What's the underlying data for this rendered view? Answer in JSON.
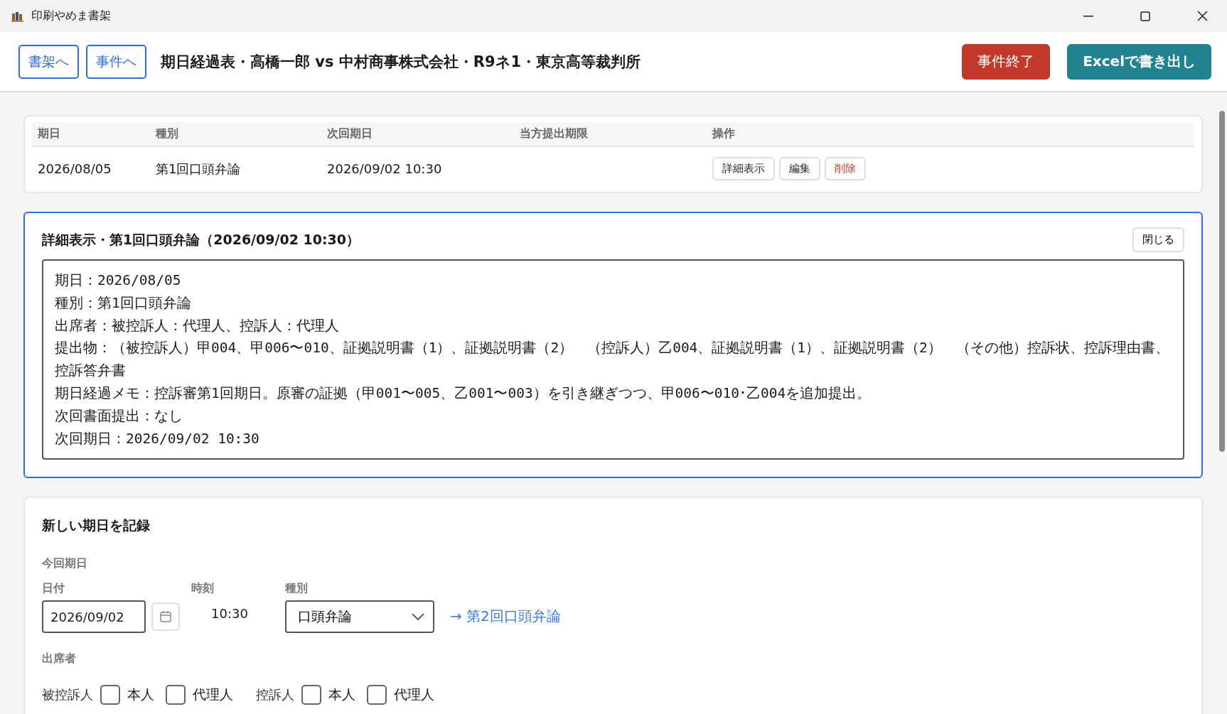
{
  "window": {
    "title": "印刷やめま書架"
  },
  "header": {
    "nav_buttons": [
      "書架へ",
      "事件へ"
    ],
    "title": "期日経過表・高橋一郎 vs 中村商事株式会社・R9ネ1・東京高等裁判所",
    "end_button": "事件終了",
    "export_button": "Excelで書き出し"
  },
  "table": {
    "columns": [
      "期日",
      "種別",
      "次回期日",
      "当方提出期限",
      "操作"
    ],
    "rows": [
      {
        "cells": [
          "2026/08/05",
          "第1回口頭弁論",
          "2026/09/02 10:30",
          ""
        ],
        "actions": [
          {
            "label": "詳細表示",
            "kind": "normal"
          },
          {
            "label": "編集",
            "kind": "normal"
          },
          {
            "label": "削除",
            "kind": "danger"
          }
        ]
      }
    ]
  },
  "detail": {
    "title": "詳細表示・第1回口頭弁論（2026/09/02 10:30）",
    "close_button": "閉じる",
    "lines": [
      "期日：2026/08/05",
      "種別：第1回口頭弁論",
      "出席者：被控訴人：代理人、控訴人：代理人",
      "提出物：（被控訴人）甲004、甲006〜010、証拠説明書（1）、証拠説明書（2）　（控訴人）乙004、証拠説明書（1）、証拠説明書（2）　（その他）控訴状、控訴理由書、控訴答弁書",
      "期日経過メモ：控訴審第1回期日。原審の証拠（甲001〜005、乙001〜003）を引き継ぎつつ、甲006〜010･乙004を追加提出。",
      "次回書面提出：なし",
      "次回期日：2026/09/02 10:30"
    ]
  },
  "form": {
    "title": "新しい期日を記録",
    "section_label": "今回期日",
    "date_label": "日付",
    "date_value": "2026/09/02",
    "time_label": "時刻",
    "time_value": "10:30",
    "type_label": "種別",
    "type_value": "口頭弁論",
    "next_link": "→ 第2回口頭弁論",
    "attendees_label": "出席者",
    "attendees": [
      {
        "party": "被控訴人",
        "options": [
          {
            "label": "本人",
            "checked": false
          },
          {
            "label": "代理人",
            "checked": false
          }
        ]
      },
      {
        "party": "控訴人",
        "options": [
          {
            "label": "本人",
            "checked": false
          },
          {
            "label": "代理人",
            "checked": false
          }
        ]
      }
    ]
  }
}
